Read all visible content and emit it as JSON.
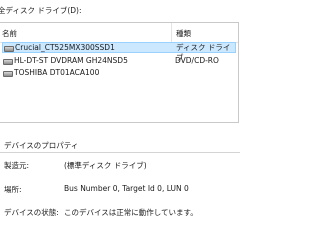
{
  "header": {
    "label": "全ディスク ドライブ(D):"
  },
  "drive_list": {
    "columns": {
      "name": "名前",
      "type": "種類"
    },
    "rows": [
      {
        "name": "Crucial_CT525MX300SSD1",
        "type": "ディスク ドライブ",
        "selected": true,
        "icon": "disk-drive-icon"
      },
      {
        "name": "HL-DT-ST DVDRAM GH24NSD5",
        "type": "DVD/CD-RO",
        "selected": false,
        "icon": "disk-drive-icon"
      },
      {
        "name": "TOSHIBA DT01ACA100",
        "type": "",
        "selected": false,
        "icon": "disk-drive-icon"
      }
    ]
  },
  "properties": {
    "title": "デバイスのプロパティ",
    "items": [
      {
        "label": "製造元:",
        "value": "(標準ディスク ドライブ)"
      },
      {
        "label": "場所:",
        "value": "Bus Number 0, Target Id 0, LUN 0"
      },
      {
        "label": "デバイスの状態:",
        "value": "このデバイスは正常に動作しています。"
      }
    ]
  },
  "colors": {
    "selection_bg": "#cce8ff",
    "selection_border": "#99d1ff"
  }
}
